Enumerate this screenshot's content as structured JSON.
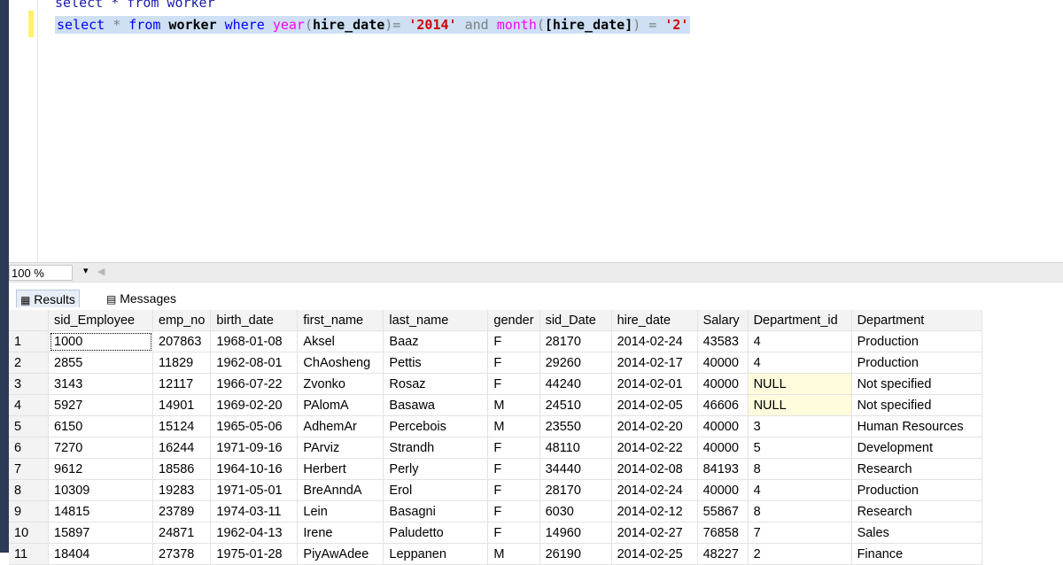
{
  "editor": {
    "line1_text": "select * from worker",
    "line2": {
      "t1": "select",
      "t2": " * ",
      "t3": "from",
      "t4": " worker ",
      "t5": "where",
      "t6": " ",
      "t7": "year",
      "t8": "(",
      "t9": "hire_date",
      "t10": ")= ",
      "t11": "'2014'",
      "t12": " and ",
      "t13": "month",
      "t14": "(",
      "t15": "[hire_date]",
      "t16": ") = ",
      "t17": "'2'"
    }
  },
  "zoom": {
    "value": "100 %"
  },
  "tabs": {
    "results": "Results",
    "messages": "Messages"
  },
  "grid": {
    "columns": [
      "",
      "sid_Employee",
      "emp_no",
      "birth_date",
      "first_name",
      "last_name",
      "gender",
      "sid_Date",
      "hire_date",
      "Salary",
      "Department_id",
      "Department"
    ],
    "rows": [
      [
        "1",
        "1000",
        "207863",
        "1968-01-08",
        "Aksel",
        "Baaz",
        "F",
        "28170",
        "2014-02-24",
        "43583",
        "4",
        "Production"
      ],
      [
        "2",
        "2855",
        "11829",
        "1962-08-01",
        "ChAosheng",
        "Pettis",
        "F",
        "29260",
        "2014-02-17",
        "40000",
        "4",
        "Production"
      ],
      [
        "3",
        "3143",
        "12117",
        "1966-07-22",
        "Zvonko",
        "Rosaz",
        "F",
        "44240",
        "2014-02-01",
        "40000",
        "NULL",
        "Not specified"
      ],
      [
        "4",
        "5927",
        "14901",
        "1969-02-20",
        "PAlomA",
        "Basawa",
        "M",
        "24510",
        "2014-02-05",
        "46606",
        "NULL",
        "Not specified"
      ],
      [
        "5",
        "6150",
        "15124",
        "1965-05-06",
        "AdhemAr",
        "Percebois",
        "M",
        "23550",
        "2014-02-20",
        "40000",
        "3",
        "Human Resources"
      ],
      [
        "6",
        "7270",
        "16244",
        "1971-09-16",
        "PArviz",
        "Strandh",
        "F",
        "48110",
        "2014-02-22",
        "40000",
        "5",
        "Development"
      ],
      [
        "7",
        "9612",
        "18586",
        "1964-10-16",
        "Herbert",
        "Perly",
        "F",
        "34440",
        "2014-02-08",
        "84193",
        "8",
        "Research"
      ],
      [
        "8",
        "10309",
        "19283",
        "1971-05-01",
        "BreAnndA",
        "Erol",
        "F",
        "28170",
        "2014-02-24",
        "40000",
        "4",
        "Production"
      ],
      [
        "9",
        "14815",
        "23789",
        "1974-03-11",
        "Lein",
        "Basagni",
        "F",
        "6030",
        "2014-02-12",
        "55867",
        "8",
        "Research"
      ],
      [
        "10",
        "15897",
        "24871",
        "1962-04-13",
        "Irene",
        "Paludetto",
        "F",
        "14960",
        "2014-02-27",
        "76858",
        "7",
        "Sales"
      ],
      [
        "11",
        "18404",
        "27378",
        "1975-01-28",
        "PiyAwAdee",
        "Leppanen",
        "M",
        "26190",
        "2014-02-25",
        "48227",
        "2",
        "Finance"
      ]
    ]
  }
}
